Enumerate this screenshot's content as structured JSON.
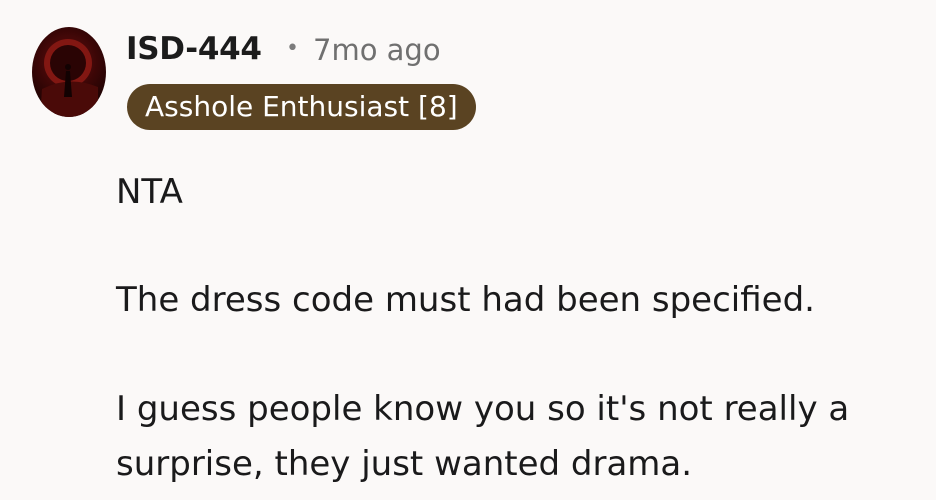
{
  "comment": {
    "author": "ISD-444",
    "separator": "•",
    "timestamp": "7mo ago",
    "flair": "Asshole Enthusiast [8]",
    "paragraphs": [
      "NTA",
      "The dress code must had been specified.",
      "I guess people know you so it's not really a surprise, they just wanted drama."
    ]
  },
  "colors": {
    "background": "#fbf9f8",
    "flair_background": "#5a4322",
    "flair_text": "#ffffff",
    "meta_text": "#707070"
  },
  "icons": {
    "avatar": "user-avatar-icon"
  }
}
